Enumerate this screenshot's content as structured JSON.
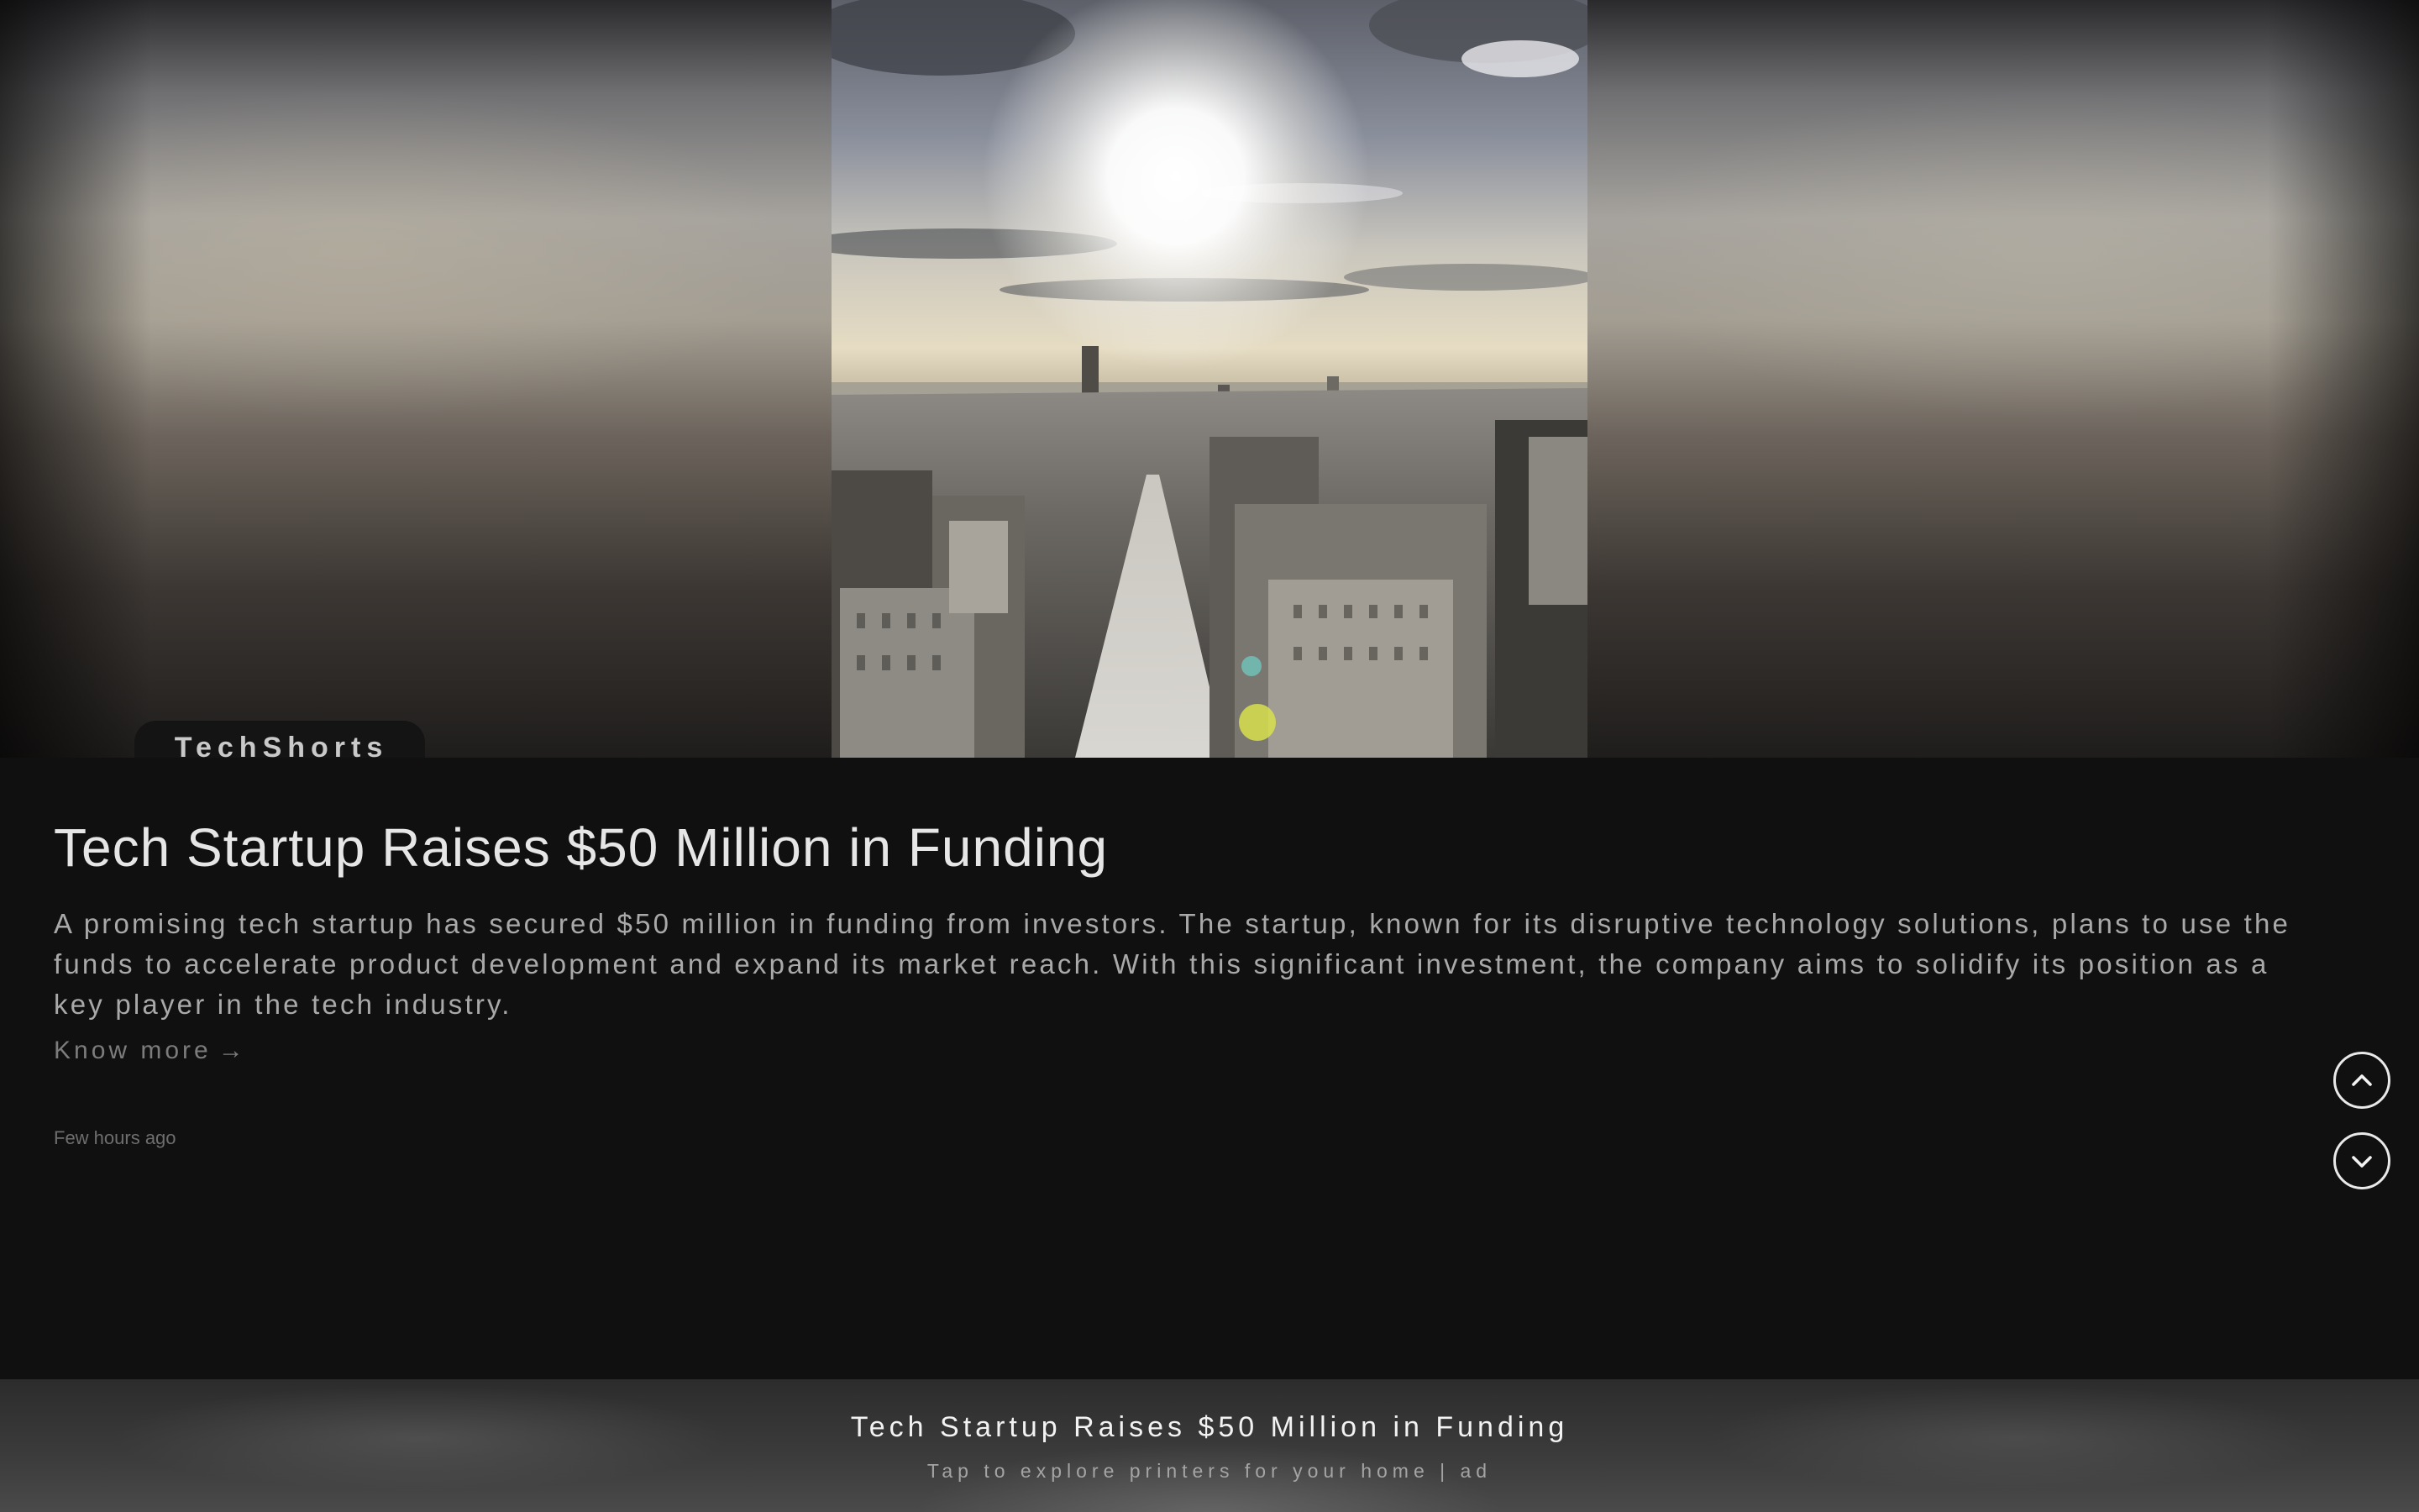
{
  "app": {
    "source_name": "TechShorts"
  },
  "article": {
    "headline": "Tech Startup Raises $50 Million in Funding",
    "summary": "A promising tech startup has secured $50 million in funding from investors. The startup, known for its disruptive technology solutions, plans to use the funds to accelerate product development and expand its market reach. With this significant investment, the company aims to solidify its position as a key player in the tech industry.",
    "know_more_label": "Know more",
    "know_more_arrow": "→",
    "timestamp": "Few hours ago",
    "image_subject": "city skyline photo"
  },
  "navigation": {
    "up_icon": "chevron-up-icon",
    "down_icon": "chevron-down-icon"
  },
  "ad": {
    "title": "Tech Startup Raises $50 Million in Funding",
    "subtitle": "Tap to explore printers for your home | ad"
  },
  "colors": {
    "background": "#101010",
    "headline": "#e6e6e6",
    "summary": "#a9a9a9",
    "muted": "#7c7c7c",
    "nav_button": "#e9e9e9"
  }
}
